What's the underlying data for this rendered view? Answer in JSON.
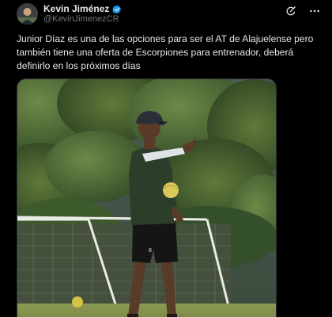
{
  "author": {
    "display_name": "Kevin Jiménez",
    "handle": "@KevinJimenezCR",
    "verified": true,
    "accent_color": "#1d9bf0"
  },
  "header_actions": [
    {
      "icon": "grok-icon"
    },
    {
      "icon": "more-icon"
    }
  ],
  "tweet": {
    "text_lines": [
      "Junior Díaz es una de las opciones para ser el AT de Alajuelense pero",
      "también tiene una oferta de Escorpiones para entrenador, deberá",
      "definirlo en los próximos días"
    ]
  },
  "media": {
    "type": "photo",
    "shorts_logo": "8"
  }
}
